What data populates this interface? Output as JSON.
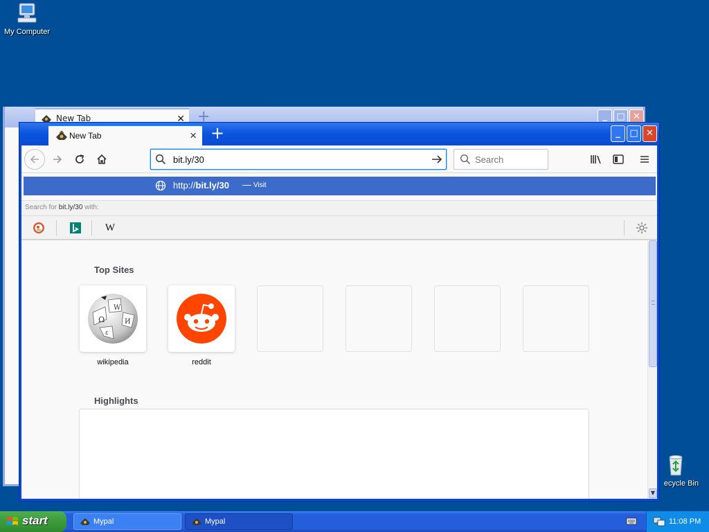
{
  "desktop": {
    "icons": [
      {
        "label": "My Computer",
        "icon": "my-computer-icon"
      },
      {
        "label": "ecycle Bin",
        "icon": "recycle-bin-icon"
      }
    ]
  },
  "back_window": {
    "tab_title": "New Tab"
  },
  "browser": {
    "tab_title": "New Tab",
    "new_tab_symbol": "+",
    "url_value": "bit.ly/30",
    "search_placeholder": "Search",
    "autocomplete": {
      "url_prefix": "http://",
      "url_bold": "bit.ly/30",
      "dash": "—",
      "action": "Visit"
    },
    "search_with": {
      "prefix": "Search for ",
      "query": "bit.ly/30",
      "suffix": " with:"
    },
    "engines": [
      {
        "name": "duckduckgo-icon"
      },
      {
        "name": "bing-icon"
      },
      {
        "name": "wikipedia-icon",
        "glyph": "W"
      }
    ],
    "top_sites_title": "Top Sites",
    "top_sites": [
      {
        "label": "wikipedia",
        "icon": "wikipedia-globe-icon"
      },
      {
        "label": "reddit",
        "icon": "reddit-icon"
      },
      {
        "label": ""
      },
      {
        "label": ""
      },
      {
        "label": ""
      },
      {
        "label": ""
      }
    ],
    "highlights_title": "Highlights"
  },
  "taskbar": {
    "start_label": "start",
    "tasks": [
      {
        "label": "Mypal"
      },
      {
        "label": "Mypal"
      }
    ],
    "clock": "11:08 PM"
  },
  "colors": {
    "desktop": "#004e98",
    "accent": "#0a84ff",
    "popup_highlight": "#3d6bc9",
    "reddit": "#ff4500"
  }
}
